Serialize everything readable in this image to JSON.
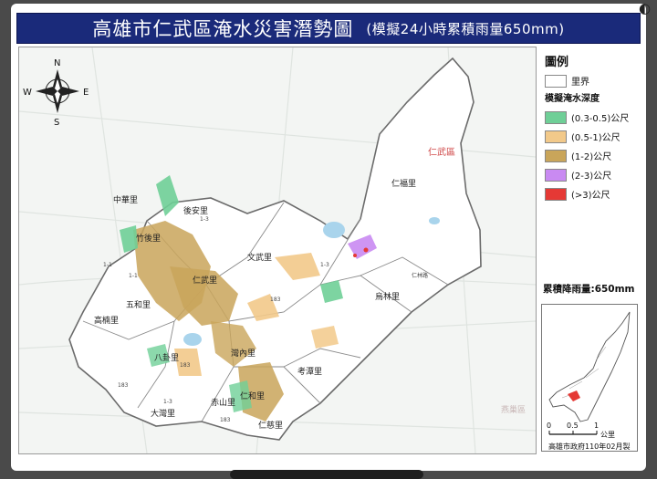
{
  "title": {
    "main": "高雄市仁武區淹水災害潛勢圖",
    "sub": "(模擬24小時累積雨量650mm)"
  },
  "map": {
    "compass": {
      "n": "N",
      "s": "S",
      "e": "E",
      "w": "W"
    },
    "district_label": "仁武區",
    "villages": [
      "中華里",
      "後安里",
      "竹後里",
      "仁武里",
      "文武里",
      "五和里",
      "高楠里",
      "八卦里",
      "灣內里",
      "大灣里",
      "赤山里",
      "仁和里",
      "仁慈里",
      "考潭里",
      "烏林里",
      "仁福里"
    ],
    "road_labels": [
      "1-1",
      "1-3",
      "183",
      "183",
      "1-3",
      "仁林路",
      "1-3",
      "183",
      "183",
      "1-1"
    ],
    "area_label": "燕巢區"
  },
  "legend": {
    "title": "圖例",
    "boundary_label": "里界",
    "depth_heading": "模擬淹水深度",
    "classes": [
      {
        "label": "(0.3-0.5)公尺",
        "color": "#6fcf97"
      },
      {
        "label": "(0.5-1)公尺",
        "color": "#f2c98a"
      },
      {
        "label": "(1-2)公尺",
        "color": "#c9a55a"
      },
      {
        "label": "(2-3)公尺",
        "color": "#c98af2"
      },
      {
        "label": "(>3)公尺",
        "color": "#e53935"
      }
    ],
    "rainfall": "累積降雨量:650mm",
    "scale": {
      "ticks": [
        "0",
        "0.5",
        "1"
      ],
      "unit": "公里"
    },
    "credit": "高雄市政府110年02月製"
  },
  "ui": {
    "corner_icon_glyph": "◐"
  }
}
